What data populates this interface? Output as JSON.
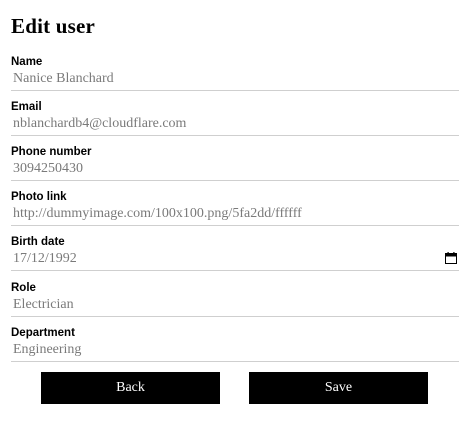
{
  "title": "Edit user",
  "fields": [
    {
      "label": "Name",
      "value": "Nanice Blanchard"
    },
    {
      "label": "Email",
      "value": "nblanchardb4@cloudflare.com"
    },
    {
      "label": "Phone number",
      "value": "3094250430"
    },
    {
      "label": "Photo link",
      "value": "http://dummyimage.com/100x100.png/5fa2dd/ffffff"
    },
    {
      "label": "Birth date",
      "value": "17/12/1992"
    },
    {
      "label": "Role",
      "value": "Electrician"
    },
    {
      "label": "Department",
      "value": "Engineering"
    }
  ],
  "buttons": {
    "back": "Back",
    "save": "Save"
  },
  "icons": {
    "birth_date": "calendar-icon"
  }
}
